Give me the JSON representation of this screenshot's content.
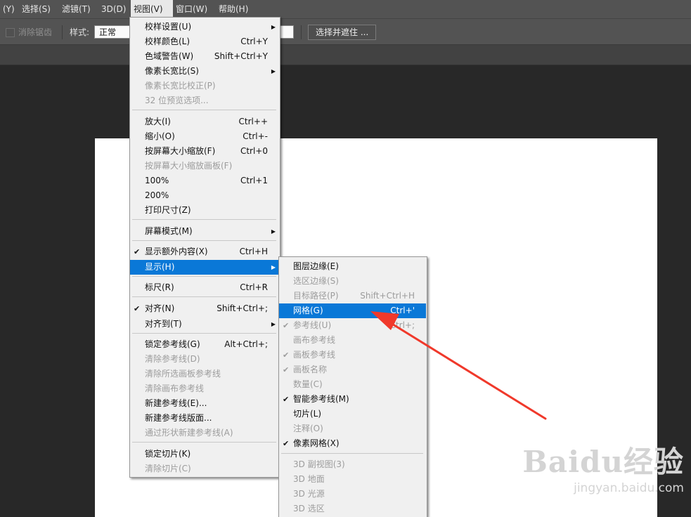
{
  "menubar": {
    "items": [
      {
        "label": "(Y)"
      },
      {
        "label": "选择(S)"
      },
      {
        "label": "滤镜(T)"
      },
      {
        "label": "3D(D)"
      },
      {
        "label": "视图(V)"
      },
      {
        "label": "窗口(W)"
      },
      {
        "label": "帮助(H)"
      }
    ]
  },
  "options": {
    "antialias": "消除锯齿",
    "style_label": "样式:",
    "style_value": "正常",
    "select_mask_button": "选择并遮住 ..."
  },
  "view_menu": {
    "items": [
      {
        "label": "校样设置(U)",
        "shortcut": "",
        "submenu": true,
        "disabled": false
      },
      {
        "label": "校样颜色(L)",
        "shortcut": "Ctrl+Y",
        "disabled": false
      },
      {
        "label": "色域警告(W)",
        "shortcut": "Shift+Ctrl+Y",
        "disabled": false
      },
      {
        "label": "像素长宽比(S)",
        "shortcut": "",
        "submenu": true,
        "disabled": false
      },
      {
        "label": "像素长宽比校正(P)",
        "shortcut": "",
        "disabled": true
      },
      {
        "label": "32 位预览选项...",
        "shortcut": "",
        "disabled": true
      },
      {
        "label": "放大(I)",
        "shortcut": "Ctrl++",
        "disabled": false
      },
      {
        "label": "缩小(O)",
        "shortcut": "Ctrl+-",
        "disabled": false
      },
      {
        "label": "按屏幕大小缩放(F)",
        "shortcut": "Ctrl+0",
        "disabled": false
      },
      {
        "label": "按屏幕大小缩放画板(F)",
        "shortcut": "",
        "disabled": true
      },
      {
        "label": "100%",
        "shortcut": "Ctrl+1",
        "disabled": false
      },
      {
        "label": "200%",
        "shortcut": "",
        "disabled": false
      },
      {
        "label": "打印尺寸(Z)",
        "shortcut": "",
        "disabled": false
      },
      {
        "label": "屏幕模式(M)",
        "shortcut": "",
        "submenu": true,
        "disabled": false
      },
      {
        "label": "显示额外内容(X)",
        "shortcut": "Ctrl+H",
        "checked": true,
        "disabled": false
      },
      {
        "label": "显示(H)",
        "shortcut": "",
        "submenu": true,
        "highlighted": true
      },
      {
        "label": "标尺(R)",
        "shortcut": "Ctrl+R",
        "disabled": false
      },
      {
        "label": "对齐(N)",
        "shortcut": "Shift+Ctrl+;",
        "checked": true,
        "disabled": false
      },
      {
        "label": "对齐到(T)",
        "shortcut": "",
        "submenu": true,
        "disabled": false
      },
      {
        "label": "锁定参考线(G)",
        "shortcut": "Alt+Ctrl+;",
        "disabled": false
      },
      {
        "label": "清除参考线(D)",
        "shortcut": "",
        "disabled": true
      },
      {
        "label": "清除所选画板参考线",
        "shortcut": "",
        "disabled": true
      },
      {
        "label": "清除画布参考线",
        "shortcut": "",
        "disabled": true
      },
      {
        "label": "新建参考线(E)...",
        "shortcut": "",
        "disabled": false
      },
      {
        "label": "新建参考线版面...",
        "shortcut": "",
        "disabled": false
      },
      {
        "label": "通过形状新建参考线(A)",
        "shortcut": "",
        "disabled": true
      },
      {
        "label": "锁定切片(K)",
        "shortcut": "",
        "disabled": false
      },
      {
        "label": "清除切片(C)",
        "shortcut": "",
        "disabled": true
      }
    ]
  },
  "show_submenu": {
    "items": [
      {
        "label": "图层边缘(E)",
        "shortcut": "",
        "disabled": false
      },
      {
        "label": "选区边缘(S)",
        "shortcut": "",
        "disabled": true
      },
      {
        "label": "目标路径(P)",
        "shortcut": "Shift+Ctrl+H",
        "disabled": true
      },
      {
        "label": "网格(G)",
        "shortcut": "Ctrl+'",
        "highlighted": true
      },
      {
        "label": "参考线(U)",
        "shortcut": "Ctrl+;",
        "checked": true,
        "disabled": true
      },
      {
        "label": "画布参考线",
        "shortcut": "",
        "disabled": true
      },
      {
        "label": "画板参考线",
        "shortcut": "",
        "checked": true,
        "disabled": true
      },
      {
        "label": "画板名称",
        "shortcut": "",
        "checked": true,
        "disabled": true
      },
      {
        "label": "数量(C)",
        "shortcut": "",
        "disabled": true
      },
      {
        "label": "智能参考线(M)",
        "shortcut": "",
        "checked": true,
        "disabled": false
      },
      {
        "label": "切片(L)",
        "shortcut": "",
        "disabled": false
      },
      {
        "label": "注释(O)",
        "shortcut": "",
        "disabled": true
      },
      {
        "label": "像素网格(X)",
        "shortcut": "",
        "checked": true,
        "disabled": false
      },
      {
        "label": "3D 副视图(3)",
        "shortcut": "",
        "disabled": true
      },
      {
        "label": "3D 地面",
        "shortcut": "",
        "disabled": true
      },
      {
        "label": "3D 光源",
        "shortcut": "",
        "disabled": true
      },
      {
        "label": "3D 选区",
        "shortcut": "",
        "disabled": true
      }
    ]
  },
  "watermark": {
    "brand": "Baidu经验",
    "url": "jingyan.baidu.com"
  },
  "colors": {
    "highlight": "#0a78d7",
    "arrow": "#f0392b",
    "menubar": "#535353",
    "workspace": "#282828"
  }
}
